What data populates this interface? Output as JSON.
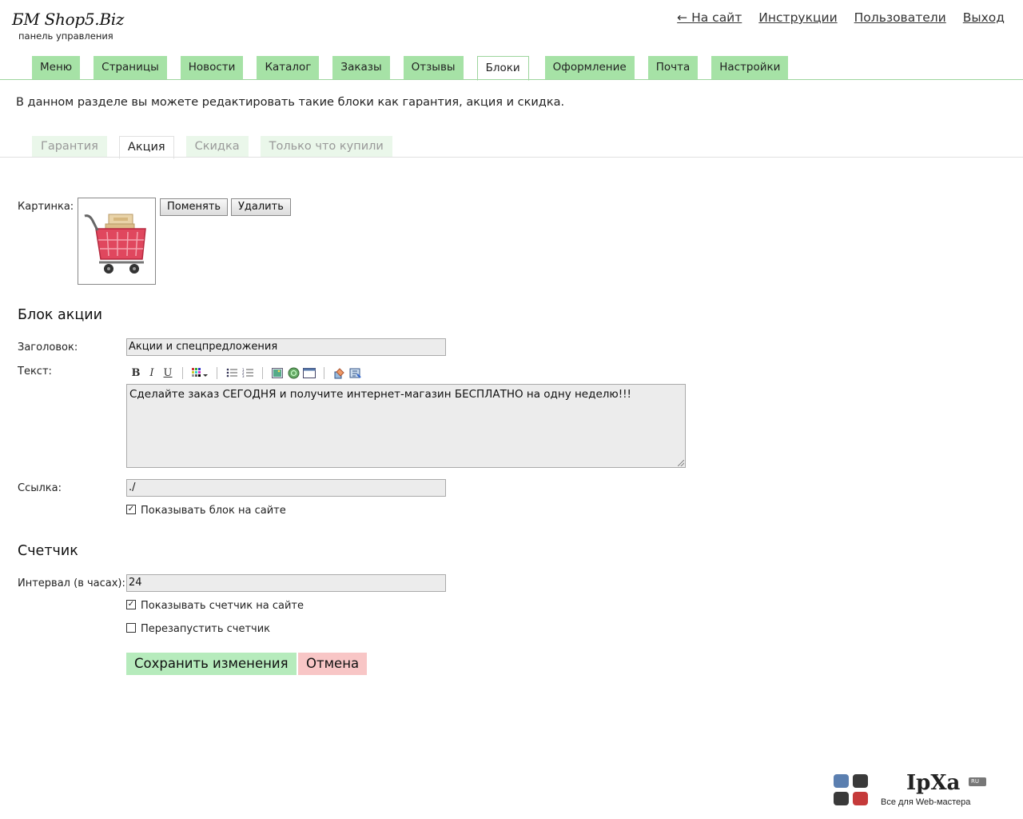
{
  "header": {
    "title": "БМ Shop5.Biz",
    "subtitle": "панель управления",
    "links": [
      "← На сайт",
      "Инструкции",
      "Пользователи",
      "Выход"
    ]
  },
  "mainnav": {
    "tabs": [
      "Меню",
      "Страницы",
      "Новости",
      "Каталог",
      "Заказы",
      "Отзывы",
      "Блоки",
      "Оформление",
      "Почта",
      "Настройки"
    ],
    "active": "Блоки"
  },
  "intro": "В данном разделе вы можете редактировать такие блоки как гарантия, акция и скидка.",
  "subnav": {
    "tabs": [
      "Гарантия",
      "Акция",
      "Скидка",
      "Только что купили"
    ],
    "active": "Акция"
  },
  "image": {
    "label": "Картинка:",
    "change_label": "Поменять",
    "delete_label": "Удалить"
  },
  "promo": {
    "section_title": "Блок акции",
    "heading_label": "Заголовок:",
    "heading_value": "Акции и спецпредложения",
    "text_label": "Текст:",
    "text_value": "Сделайте заказ СЕГОДНЯ и получите интернет-магазин БЕСПЛАТНО на одну неделю!!!",
    "link_label": "Ссылка:",
    "link_value": "./",
    "show_label": "Показывать блок на сайте",
    "show_checked": true
  },
  "editor_toolbar": {
    "bold": "B",
    "italic": "I",
    "underline": "U"
  },
  "counter": {
    "section_title": "Счетчик",
    "interval_label": "Интервал (в часах):",
    "interval_value": "24",
    "show_label": "Показывать счетчик на сайте",
    "show_checked": true,
    "restart_label": "Перезапустить счетчик",
    "restart_checked": false
  },
  "actions": {
    "save_label": "Сохранить изменения",
    "cancel_label": "Отмена"
  },
  "watermark": {
    "brand": "IpXa",
    "badge": "RU",
    "tagline": "Все для Web-мастера"
  }
}
